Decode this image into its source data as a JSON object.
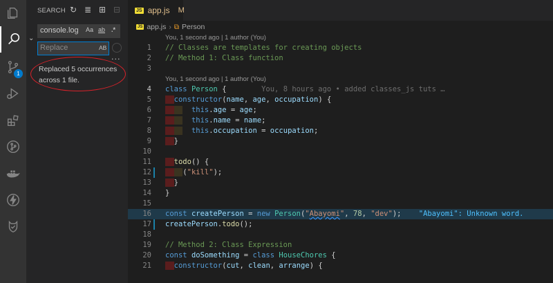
{
  "activity_bar": {
    "items": [
      {
        "name": "explorer-icon"
      },
      {
        "name": "search-icon"
      },
      {
        "name": "source-control-icon",
        "badge": "1"
      },
      {
        "name": "run-debug-icon"
      },
      {
        "name": "extensions-icon"
      },
      {
        "name": "git-graph-icon"
      },
      {
        "name": "docker-icon"
      },
      {
        "name": "thunder-client-icon"
      },
      {
        "name": "remote-icon"
      }
    ]
  },
  "sidebar": {
    "title": "SEARCH",
    "search_value": "console.log",
    "match_case": "Aa",
    "whole_word": "ab",
    "regex": ".*",
    "replace_placeholder": "Replace",
    "preserve_case": "AB",
    "more": "···",
    "result_message": "Replaced 5 occurrences across 1 file."
  },
  "editor": {
    "tab": {
      "badge": "JS",
      "label": "app.js",
      "modified": "M"
    },
    "breadcrumb": {
      "file": "app.js",
      "symbol": "Person"
    },
    "codelens_1": "You, 1 second ago | 1 author (You)",
    "codelens_2": "You, 1 second ago | 1 author (You)",
    "blame_line4": "You, 8 hours ago • added classes_js tuts …",
    "diagnostic_line16": "\"Abayomi\": Unknown word.",
    "line_numbers": [
      "1",
      "2",
      "3",
      "4",
      "5",
      "6",
      "7",
      "8",
      "9",
      "10",
      "11",
      "12",
      "13",
      "14",
      "15",
      "16",
      "17",
      "18",
      "19",
      "20",
      "21"
    ]
  },
  "colors": {
    "accent": "#007acc",
    "comment": "#6a9955",
    "keyword": "#569cd6",
    "string": "#ce9178",
    "annotation_circle": "#d9222a"
  }
}
